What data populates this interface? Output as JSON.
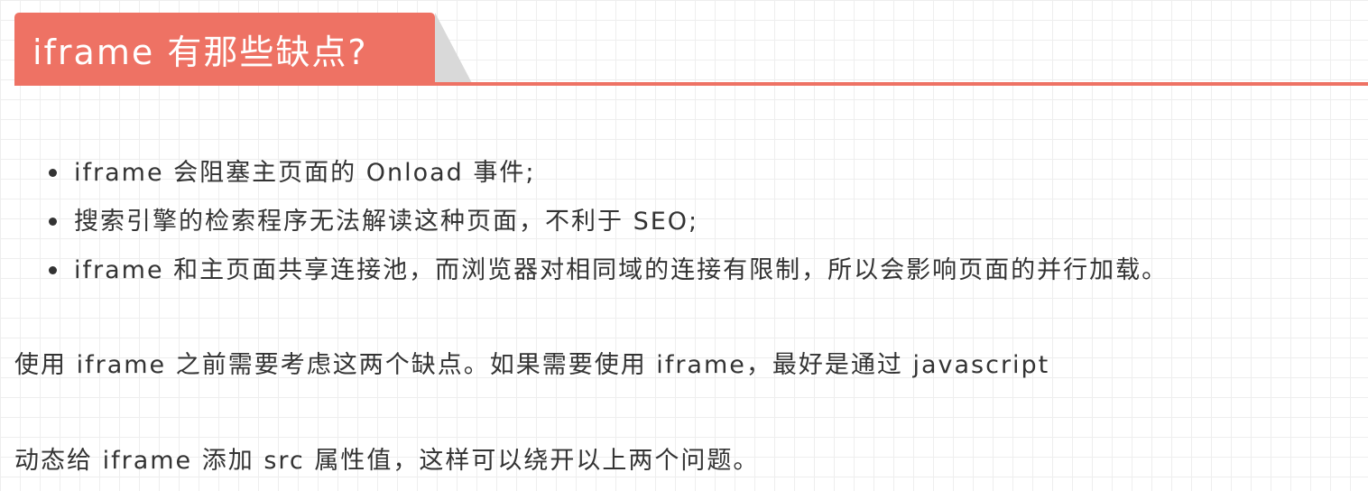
{
  "heading": {
    "title": "iframe 有那些缺点?"
  },
  "bullets": [
    {
      "text": "iframe 会阻塞主页面的 Onload 事件;"
    },
    {
      "text": "搜索引擎的检索程序无法解读这种页面，不利于 SEO;"
    },
    {
      "text": "iframe 和主页面共享连接池，而浏览器对相同域的连接有限制，所以会影响页面的并行加载。"
    }
  ],
  "paragraphs": [
    {
      "text": "使用 iframe 之前需要考虑这两个缺点。如果需要使用 iframe，最好是通过 javascript"
    },
    {
      "text": "动态给 iframe 添加 src 属性值，这样可以绕开以上两个问题。"
    }
  ]
}
